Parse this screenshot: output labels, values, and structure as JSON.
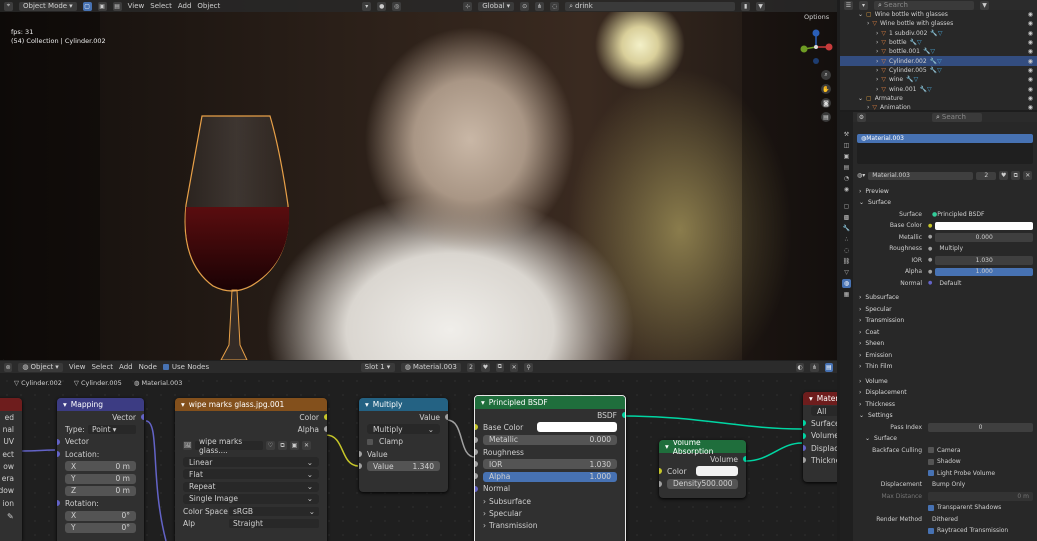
{
  "viewport": {
    "header": {
      "mode": "Object Mode",
      "menus": [
        "View",
        "Select",
        "Add",
        "Object"
      ],
      "orientation": "Global",
      "search_value": "drink",
      "options": "Options"
    },
    "overlay": {
      "fps": "fps: 31",
      "collection": "(54) Collection | Cylinder.002"
    }
  },
  "node_editor": {
    "header": {
      "type": "Object",
      "menus": [
        "View",
        "Select",
        "Add",
        "Node"
      ],
      "use_nodes": "Use Nodes",
      "slot": "Slot 1",
      "material": "Material.003",
      "users": "2"
    },
    "breadcrumb": [
      "Cylinder.002",
      "Cylinder.005",
      "Material.003"
    ],
    "partial_left_node": {
      "rows": [
        "ed",
        "nal",
        "UV",
        "ect",
        "ow",
        "era",
        "dow",
        "ion"
      ]
    },
    "mapping": {
      "title": "Mapping",
      "output": "Vector",
      "type_label": "Type:",
      "type_value": "Point",
      "vector_label": "Vector",
      "location_label": "Location:",
      "x_label": "X",
      "x_val": "0 m",
      "y_label": "Y",
      "y_val": "0 m",
      "z_label": "Z",
      "z_val": "0 m",
      "rotation_label": "Rotation:",
      "rx_val": "0°",
      "ry_val": "0°"
    },
    "image_texture": {
      "title": "wipe marks glass.jpg.001",
      "out_color": "Color",
      "out_alpha": "Alpha",
      "image_name": "wipe marks glass....",
      "interpolation": "Linear",
      "projection": "Flat",
      "extension": "Repeat",
      "source": "Single Image",
      "color_space_label": "Color Space",
      "color_space": "sRGB",
      "alpha_label": "Alp",
      "alpha_value": "Straight"
    },
    "multiply": {
      "title": "Multiply",
      "out_value": "Value",
      "operation": "Multiply",
      "clamp": "Clamp",
      "in_value": "Value",
      "value_label": "Value",
      "value": "1.340"
    },
    "bsdf": {
      "title": "Principled BSDF",
      "out": "BSDF",
      "base_color": "Base Color",
      "metallic_label": "Metallic",
      "metallic": "0.000",
      "roughness": "Roughness",
      "ior_label": "IOR",
      "ior": "1.030",
      "alpha_label": "Alpha",
      "alpha": "1.000",
      "normal": "Normal",
      "subsurface": "Subsurface",
      "specular": "Specular",
      "transmission": "Transmission"
    },
    "volume_absorption": {
      "title": "Volume Absorption",
      "out": "Volume",
      "color": "Color",
      "density_label": "Density",
      "density": "500.000"
    },
    "output": {
      "title": "Materi",
      "target": "All",
      "surface": "Surface",
      "volume": "Volume",
      "displacement": "Displacer",
      "thickness": "Thickne"
    }
  },
  "outliner": {
    "search_placeholder": "Search",
    "items": [
      {
        "label": "Wine bottle with glasses",
        "indent": 0
      },
      {
        "label": "Wine bottle with glasses",
        "indent": 1
      },
      {
        "label": "1 subdiv.002",
        "indent": 2
      },
      {
        "label": "bottle",
        "indent": 2
      },
      {
        "label": "bottle.001",
        "indent": 2
      },
      {
        "label": "Cylinder.002",
        "indent": 2,
        "selected": true
      },
      {
        "label": "Cylinder.005",
        "indent": 2
      },
      {
        "label": "wine",
        "indent": 2
      },
      {
        "label": "wine.001",
        "indent": 2
      },
      {
        "label": "Armature",
        "indent": 0
      },
      {
        "label": "Animation",
        "indent": 1
      }
    ]
  },
  "properties": {
    "search_placeholder": "Search",
    "slot": "Material.003",
    "material_name": "Material.003",
    "users": "2",
    "preview": "Preview",
    "surface_section": "Surface",
    "surface_label": "Surface",
    "surface_value": "Principled BSDF",
    "base_color_label": "Base Color",
    "metallic_label": "Metallic",
    "metallic": "0.000",
    "roughness_label": "Roughness",
    "roughness": "Multiply",
    "ior_label": "IOR",
    "ior": "1.030",
    "alpha_label": "Alpha",
    "alpha": "1.000",
    "normal_label": "Normal",
    "normal": "Default",
    "subsections": [
      "Subsurface",
      "Specular",
      "Transmission",
      "Coat",
      "Sheen",
      "Emission",
      "Thin Film"
    ],
    "volume": "Volume",
    "displacement": "Displacement",
    "thickness": "Thickness",
    "settings": "Settings",
    "pass_index_label": "Pass Index",
    "pass_index": "0",
    "surface_sub": "Surface",
    "backface_label": "Backface Culling",
    "camera": "Camera",
    "shadow": "Shadow",
    "light_probe": "Light Probe Volume",
    "displacement_label": "Displacement",
    "displacement_value": "Bump Only",
    "max_distance_label": "Max Distance",
    "max_distance": "0 m",
    "transparent_shadows": "Transparent Shadows",
    "render_method_label": "Render Method",
    "render_method": "Dithered",
    "raytraced": "Raytraced Transmission"
  },
  "colors": {
    "accent": "#4772b3",
    "mapping_header": "#3c3c83",
    "texture_header": "#83501c",
    "multiply_header": "#246283",
    "bsdf_header": "#1f6e3c",
    "output_header": "#6e1d1d",
    "socket_yellow": "#c7c729",
    "socket_green": "#00d6a3"
  }
}
